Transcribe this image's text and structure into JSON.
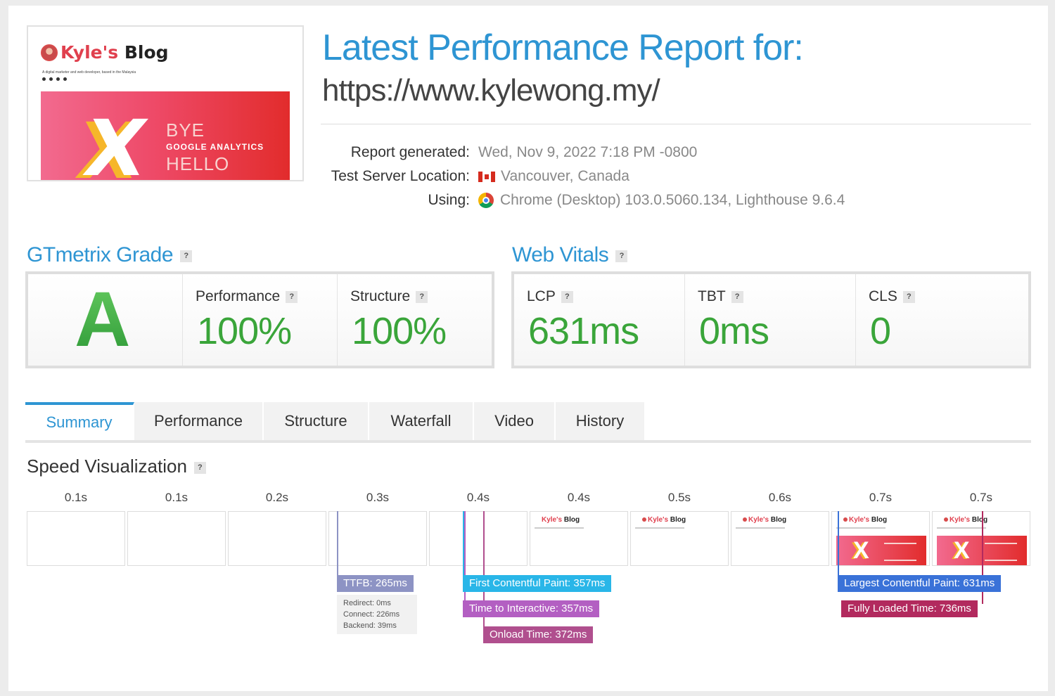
{
  "thumbnail": {
    "brand_kyle": "Kyle's",
    "brand_blog": "Blog",
    "tagline": "A digital marketer and web developer, based in the Malaysia",
    "banner_line1": "BYE",
    "banner_line2": "GOOGLE ANALYTICS",
    "banner_line3": "HELLO"
  },
  "header": {
    "title": "Latest Performance Report for:",
    "url": "https://www.kylewong.my/"
  },
  "meta": {
    "report_generated_label": "Report generated:",
    "report_generated_value": "Wed, Nov 9, 2022 7:18 PM -0800",
    "location_label": "Test Server Location:",
    "location_value": "Vancouver, Canada",
    "using_label": "Using:",
    "using_value": "Chrome (Desktop) 103.0.5060.134, Lighthouse 9.6.4"
  },
  "gtmetrix_grade": {
    "title": "GTmetrix Grade",
    "help": "?",
    "grade": "A",
    "performance_label": "Performance",
    "performance_value": "100%",
    "structure_label": "Structure",
    "structure_value": "100%"
  },
  "web_vitals": {
    "title": "Web Vitals",
    "help": "?",
    "lcp_label": "LCP",
    "lcp_value": "631ms",
    "tbt_label": "TBT",
    "tbt_value": "0ms",
    "cls_label": "CLS",
    "cls_value": "0"
  },
  "tabs": [
    "Summary",
    "Performance",
    "Structure",
    "Waterfall",
    "Video",
    "History"
  ],
  "speed_visualization": {
    "title": "Speed Visualization",
    "help": "?",
    "frame_labels": [
      "0.1s",
      "0.1s",
      "0.2s",
      "0.3s",
      "0.4s",
      "0.4s",
      "0.5s",
      "0.6s",
      "0.7s",
      "0.7s"
    ],
    "frame_brand_kyle": "Kyle's",
    "frame_brand_blog": "Blog",
    "markers": {
      "ttfb": "TTFB: 265ms",
      "fcp": "First Contentful Paint: 357ms",
      "tti": "Time to Interactive: 357ms",
      "onload": "Onload Time: 372ms",
      "lcp": "Largest Contentful Paint: 631ms",
      "fully_loaded": "Fully Loaded Time: 736ms"
    },
    "ttfb_breakdown": [
      "Redirect: 0ms",
      "Connect: 226ms",
      "Backend: 39ms"
    ]
  },
  "colors": {
    "accent_blue": "#2e95d3",
    "grade_green": "#3aa53a",
    "ttfb": "#8d93c4",
    "fcp": "#29b6e8",
    "tti": "#b35fc2",
    "onload": "#b04f8e",
    "lcp": "#3a72d8",
    "fully_loaded": "#b22a5e"
  }
}
